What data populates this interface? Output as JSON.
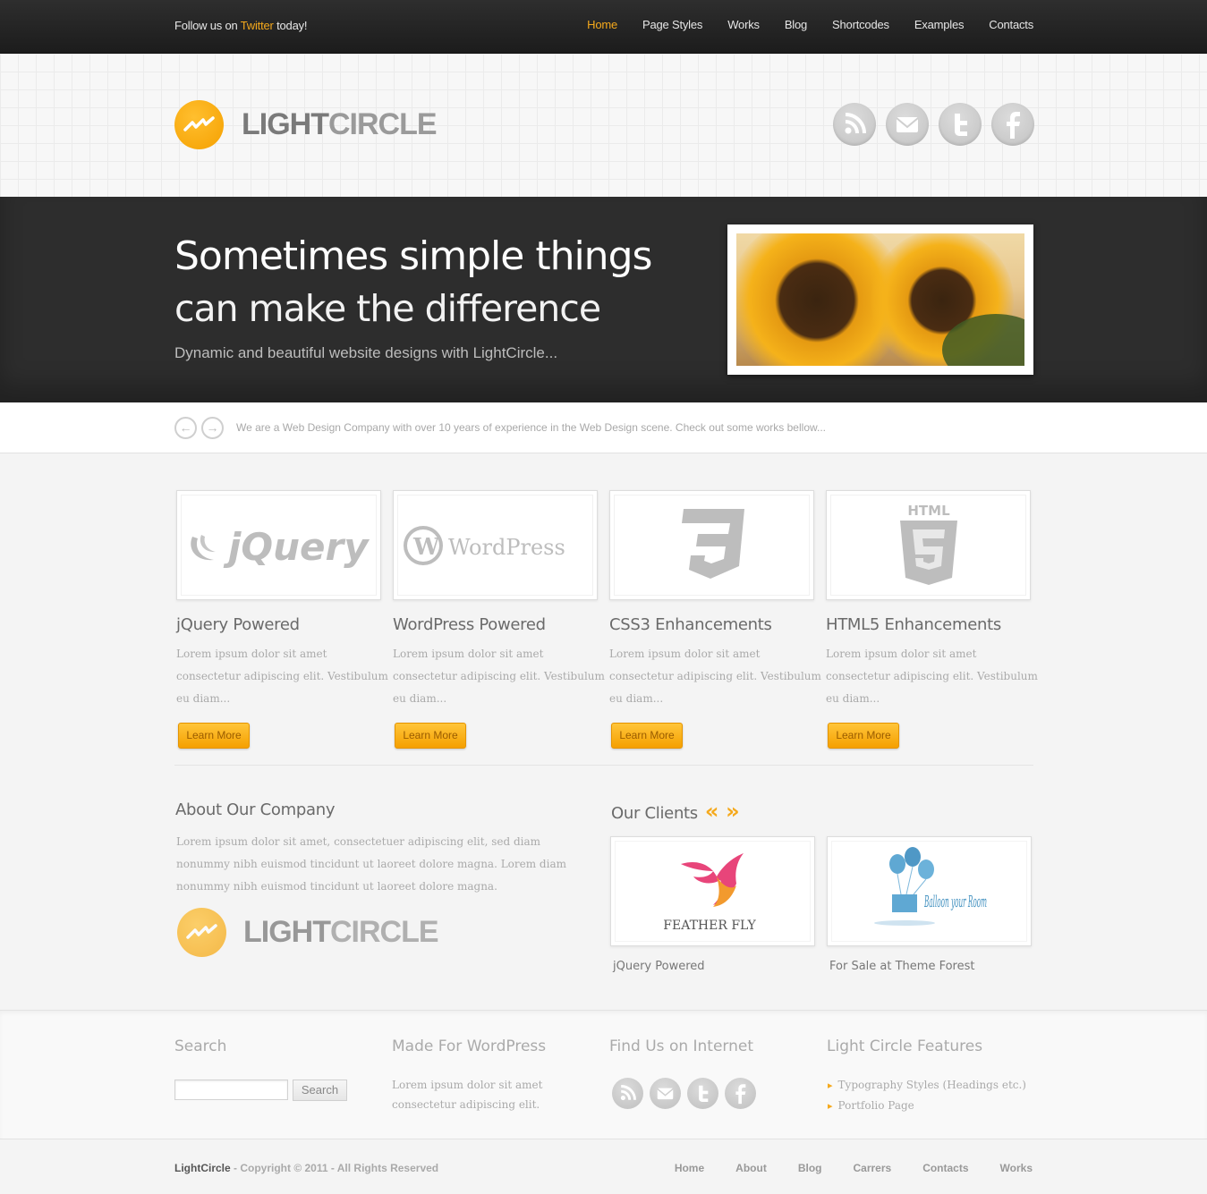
{
  "topbar": {
    "follow_prefix": "Follow us on",
    "follow_link": "Twitter",
    "follow_suffix": "today!"
  },
  "nav": {
    "items": [
      "Home",
      "Page Styles",
      "Works",
      "Blog",
      "Shortcodes",
      "Examples",
      "Contacts"
    ],
    "active": "Home"
  },
  "logo": {
    "part1": "LIGHT",
    "part2": "CIRCLE"
  },
  "social": [
    "rss-icon",
    "mail-icon",
    "twitter-icon",
    "facebook-icon"
  ],
  "hero": {
    "headline_line1": "Sometimes simple things",
    "headline_line2": "can make the difference",
    "subheadline": "Dynamic and beautiful website designs with LightCircle..."
  },
  "strip": {
    "prev_icon": "arrow-left-icon",
    "next_icon": "arrow-right-icon",
    "message": "We are a Web Design Company with over 10 years of experience in the Web Design scene. Check out some works bellow..."
  },
  "features": [
    {
      "logo_text": "jQuery",
      "title": "jQuery Powered",
      "text": "Lorem ipsum dolor sit amet consectetur adipiscing elit. Vestibulum eu diam...",
      "button": "Learn More"
    },
    {
      "logo_text": "WordPress",
      "title": "WordPress Powered",
      "text": "Lorem ipsum dolor sit amet consectetur adipiscing elit. Vestibulum eu diam...",
      "button": "Learn More"
    },
    {
      "logo_text": "",
      "title": "CSS3 Enhancements",
      "text": "Lorem ipsum dolor sit amet consectetur adipiscing elit. Vestibulum eu diam...",
      "button": "Learn More"
    },
    {
      "logo_text": "HTML",
      "title": "HTML5 Enhancements",
      "text": "Lorem ipsum dolor sit amet consectetur adipiscing elit. Vestibulum eu diam...",
      "button": "Learn More"
    }
  ],
  "about": {
    "title": "About Our Company",
    "text": "Lorem ipsum dolor sit amet, consectetuer adipiscing elit, sed diam nonummy nibh euismod tincidunt ut laoreet dolore magna. Lorem diam nonummy nibh euismod tincidunt ut laoreet dolore magna."
  },
  "clients": {
    "title": "Our Clients",
    "prev": "«",
    "next": "»",
    "items": [
      {
        "logo_text": "FEATHER FLY",
        "caption": "jQuery Powered"
      },
      {
        "logo_text": "Balloon your Room",
        "caption": "For Sale at Theme Forest"
      }
    ]
  },
  "footer": {
    "search_title": "Search",
    "search_button": "Search",
    "search_value": "",
    "wp_title": "Made For WordPress",
    "wp_text": "Lorem ipsum dolor sit amet consectetur adipiscing elit.",
    "find_title": "Find Us on Internet",
    "features_title": "Light Circle Features",
    "features_list": [
      "Typography Styles (Headings etc.)",
      "Portfolio Page"
    ]
  },
  "bottom": {
    "brand": "LightCircle",
    "copyright": " - Copyright © 2011 - All Rights Reserved",
    "links": [
      "Home",
      "About",
      "Blog",
      "Carrers",
      "Contacts",
      "Works"
    ]
  },
  "colors": {
    "accent": "#f5a91c",
    "dark": "#2d2d2d"
  }
}
